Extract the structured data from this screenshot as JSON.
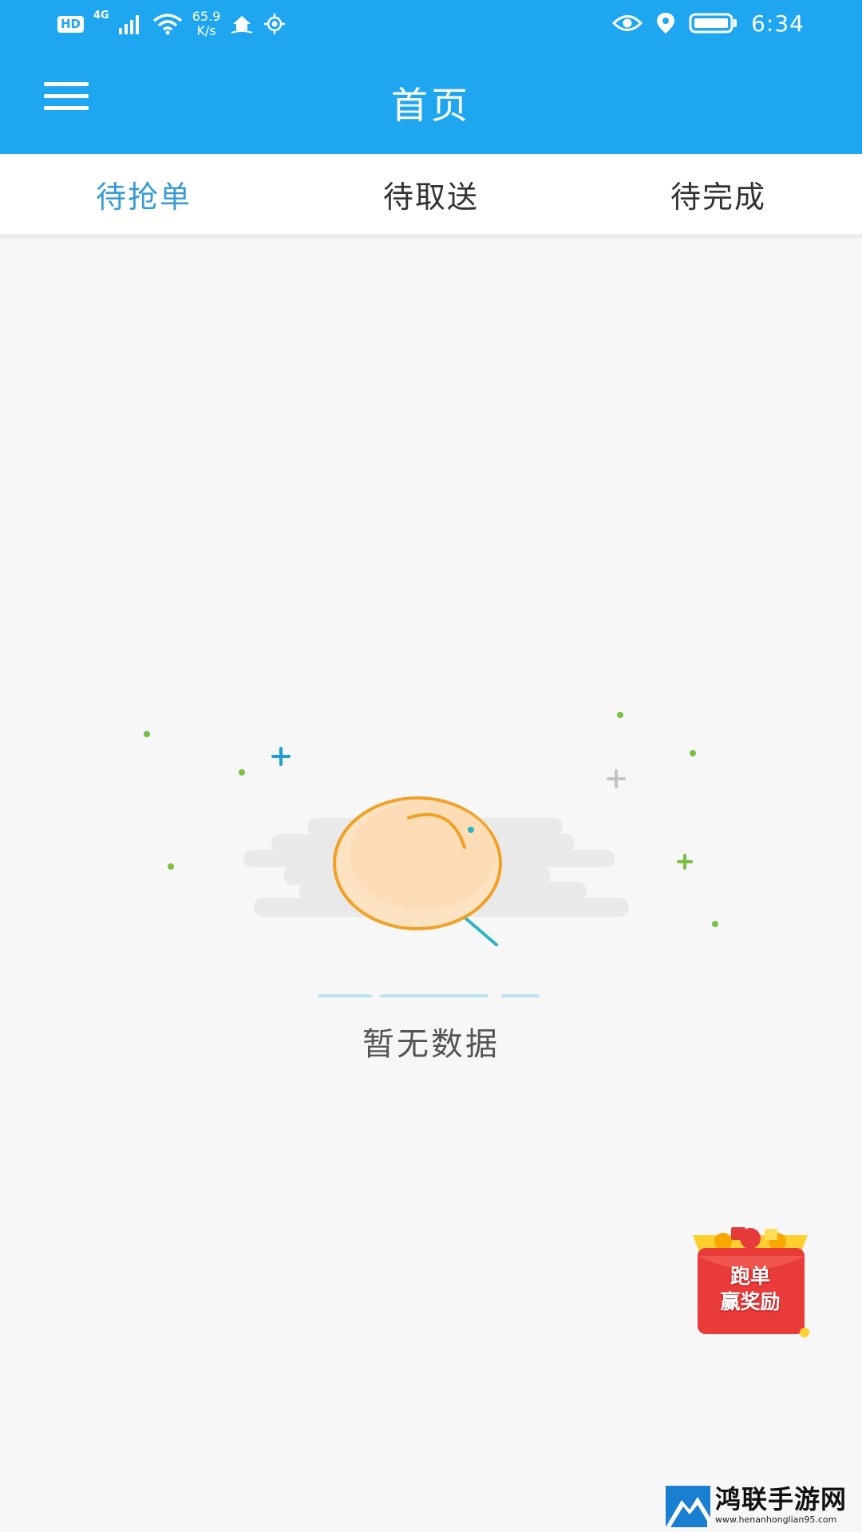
{
  "status_bar": {
    "hd_badge": "HD",
    "network_type": "4G",
    "speed_value": "65.9",
    "speed_unit": "K/s",
    "time": "6:34",
    "left_icons": [
      "signal-icon",
      "wifi-icon",
      "home-icon",
      "location-target-icon"
    ],
    "right_icons": [
      "eye-icon",
      "location-pin-icon",
      "battery-icon"
    ]
  },
  "app_bar": {
    "title": "首页",
    "menu_icon": "menu-icon",
    "background": "#1fa6f0"
  },
  "tabs": [
    {
      "label": "待抢单",
      "active": true
    },
    {
      "label": "待取送",
      "active": false
    },
    {
      "label": "待完成",
      "active": false
    }
  ],
  "empty_state": {
    "message": "暂无数据",
    "icon": "magnifier-empty-icon"
  },
  "promo": {
    "line1": "跑单",
    "line2": "赢奖励",
    "icon": "red-envelope-icon"
  },
  "watermark": {
    "title": "鸿联手游网",
    "url": "www.henanhonglian95.com"
  },
  "colors": {
    "accent": "#1fa6f0",
    "active_tab": "#3a9bd5",
    "background": "#f7f7f7"
  }
}
